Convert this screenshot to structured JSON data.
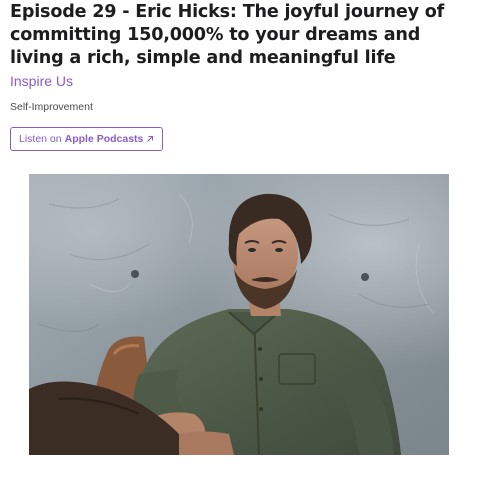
{
  "episode": {
    "title": "Episode 29 - Eric Hicks: The joyful journey of committing 150,000% to your dreams and living a rich, simple and meaningful life",
    "show_name": "Inspire Us",
    "category": "Self-Improvement"
  },
  "listen_button": {
    "prefix": "Listen on",
    "platform": "Apple Podcasts",
    "icon": "external-arrow-icon"
  },
  "artwork": {
    "description_icon": "podcast-cover-photo"
  },
  "colors": {
    "accent": "#8a5cc4",
    "title": "#1d1d1f",
    "category": "#4a4a4a"
  }
}
